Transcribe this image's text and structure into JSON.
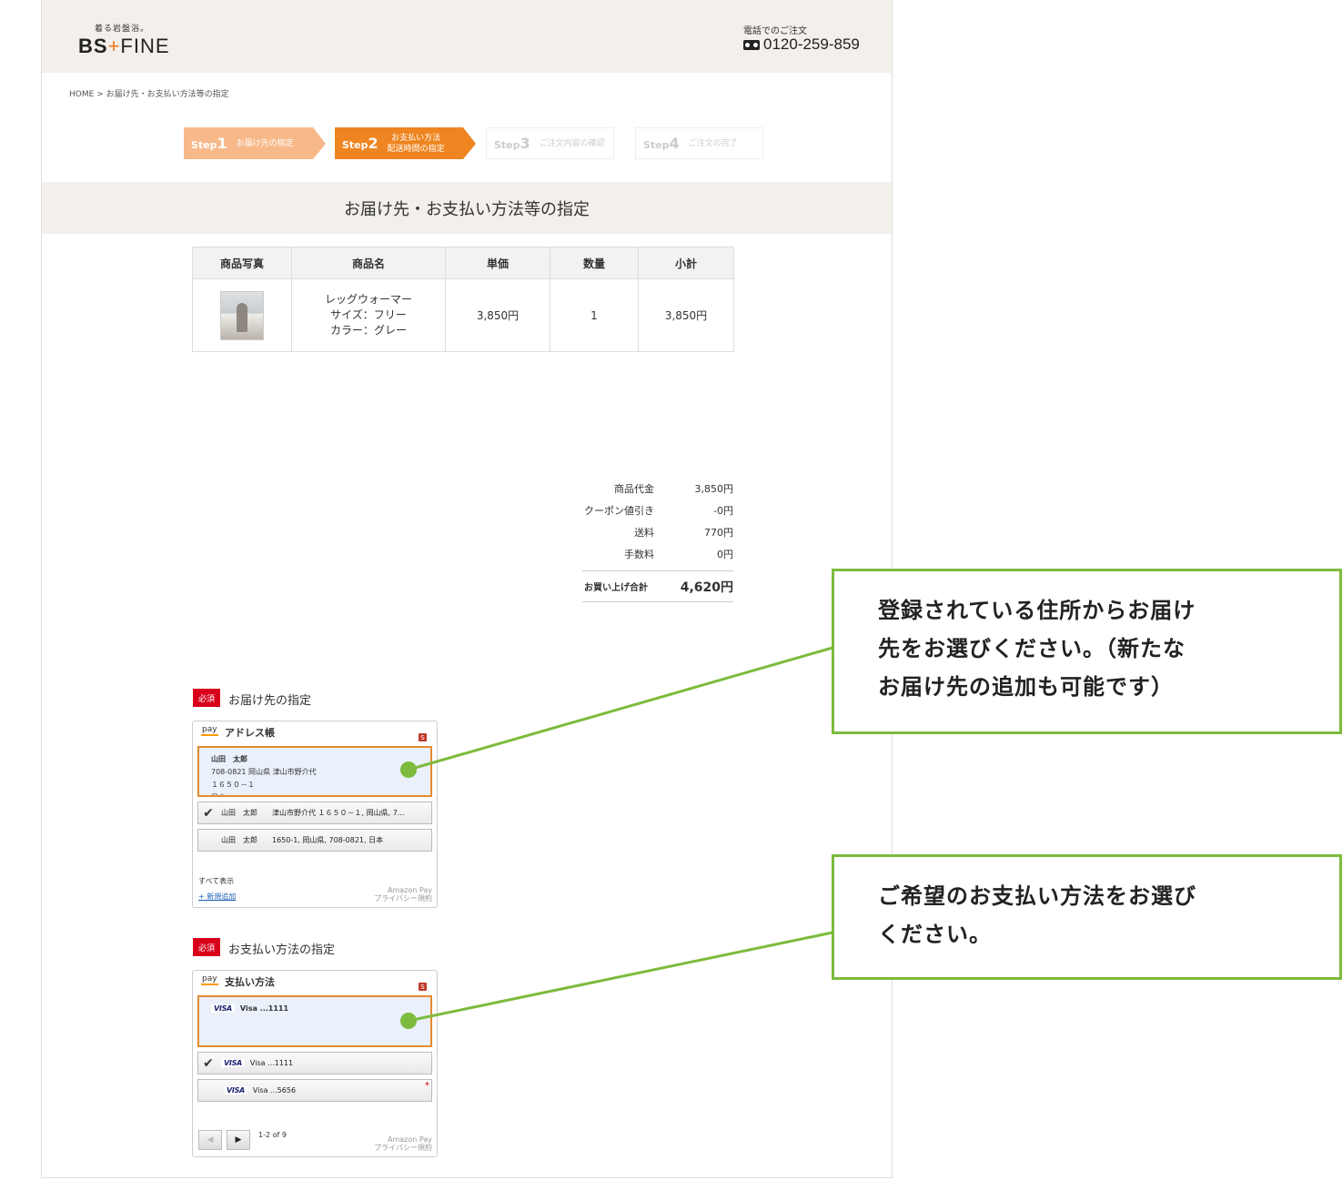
{
  "header": {
    "logo_tagline": "着る岩盤浴。",
    "logo_bs": "BS",
    "logo_plus": "+",
    "logo_fine": "FINE",
    "tel_label": "電話でのご注文",
    "tel_number": "0120-259-859",
    "tel_icon": "free-dial-icon"
  },
  "breadcrumb": {
    "home": "HOME",
    "sep": ">",
    "current": "お届け先・お支払い方法等の指定"
  },
  "steps": [
    {
      "word": "Step",
      "num": "1",
      "label": "お届け先の指定",
      "state": "done"
    },
    {
      "word": "Step",
      "num": "2",
      "label_1": "お支払い方法",
      "label_2": "配送時間の指定",
      "state": "active"
    },
    {
      "word": "Step",
      "num": "3",
      "label": "ご注文内容の確認",
      "state": "inactive"
    },
    {
      "word": "Step",
      "num": "4",
      "label": "ご注文の完了",
      "state": "inactive"
    }
  ],
  "page_title": "お届け先・お支払い方法等の指定",
  "cart": {
    "headers": [
      "商品写真",
      "商品名",
      "単価",
      "数量",
      "小計"
    ],
    "rows": [
      {
        "name": "レッグウォーマー",
        "size": "サイズ：フリー",
        "color": "カラー：グレー",
        "unit_price": "3,850円",
        "qty": "1",
        "subtotal": "3,850円"
      }
    ]
  },
  "summary": {
    "items": [
      {
        "label": "商品代金",
        "value": "3,850円"
      },
      {
        "label": "クーポン値引き",
        "value": "-0円"
      },
      {
        "label": "送料",
        "value": "770円"
      },
      {
        "label": "手数料",
        "value": "0円"
      }
    ],
    "total_label": "お買い上げ合計",
    "total_value": "4,620円"
  },
  "required_badge": "必須",
  "address_section": {
    "title": "お届け先の指定",
    "pay_logo": "pay",
    "widget_title": "アドレス帳",
    "secure_badge": "S",
    "selected": {
      "name": "山田　太郎",
      "line1": "708-0821 岡山県 津山市野介代",
      "line2": "１６５０－１",
      "line3": "日本"
    },
    "options": [
      {
        "text": "山田　太郎　　津山市野介代 １６５０－１, 岡山県, 7...",
        "checked": true
      },
      {
        "text": "山田　太郎　　1650-1, 岡山県, 708-0821, 日本",
        "checked": false
      }
    ],
    "check_mark": "✔",
    "show_all": "すべて表示",
    "add_new": "+ 新規追加",
    "footer_1": "Amazon Pay",
    "footer_2": "プライバシー規約"
  },
  "payment_section": {
    "title": "お支払い方法の指定",
    "pay_logo": "pay",
    "widget_title": "支払い方法",
    "secure_badge": "S",
    "selected": {
      "brand": "VISA",
      "text": "Visa ...1111"
    },
    "options": [
      {
        "brand": "VISA",
        "text": "Visa ...1111",
        "checked": true
      },
      {
        "brand": "VISA",
        "text": "Visa ...5656",
        "checked": false,
        "flag": "*"
      }
    ],
    "check_mark": "✔",
    "pager_prev": "◀",
    "pager_next": "▶",
    "pager_text": "1-2 of 9",
    "footer_1": "Amazon Pay",
    "footer_2": "プライバシー規約"
  },
  "callouts": [
    {
      "line1": "登録されている住所からお届け",
      "line2": "先をお選びください。（新たな",
      "line3": "お届け先の追加も可能です）"
    },
    {
      "line1": "ご希望のお支払い方法をお選び",
      "line2": "ください。"
    }
  ],
  "colors": {
    "header_bg": "#f3efea",
    "step_done": "#f7b98a",
    "step_active": "#ef8520",
    "required": "#d9001b",
    "selected_border": "#e58b2e",
    "callout_green": "#7cbb3c"
  }
}
